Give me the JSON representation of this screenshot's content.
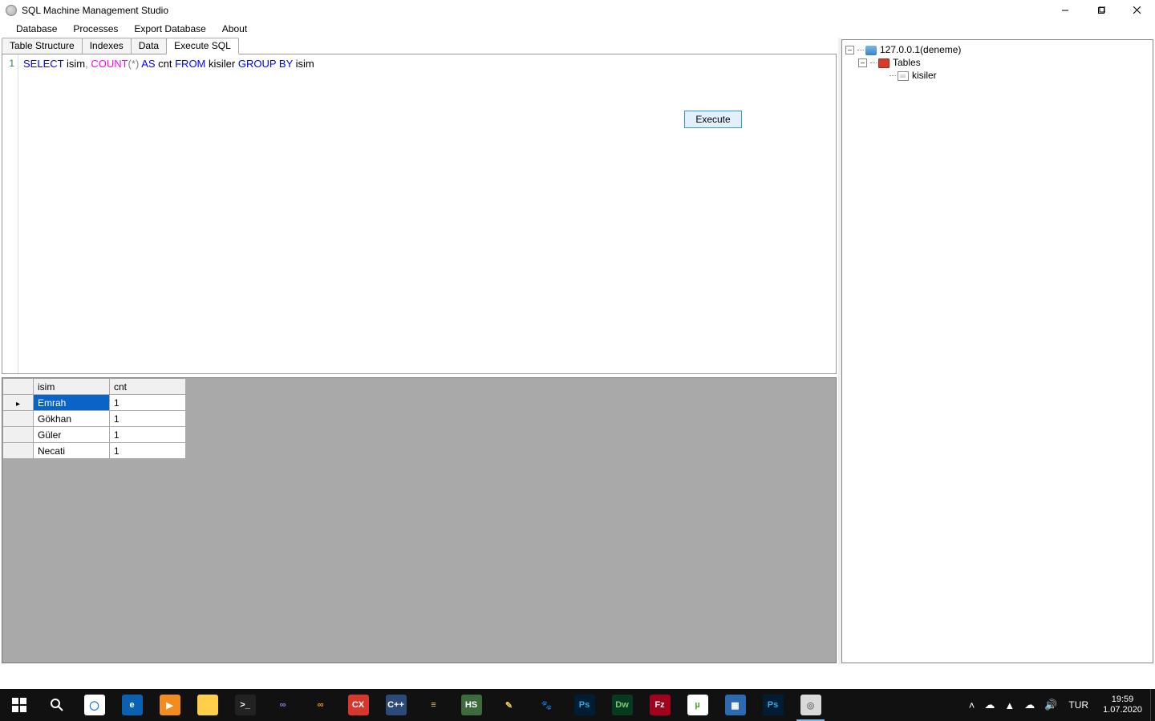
{
  "window": {
    "title": "SQL Machine Management Studio"
  },
  "menu": {
    "items": [
      "Database",
      "Processes",
      "Export Database",
      "About"
    ]
  },
  "tabs": {
    "items": [
      {
        "label": "Table Structure",
        "active": false
      },
      {
        "label": "Indexes",
        "active": false
      },
      {
        "label": "Data",
        "active": false
      },
      {
        "label": "Execute SQL",
        "active": true
      }
    ]
  },
  "editor": {
    "line_numbers": [
      "1"
    ],
    "sql_tokens": [
      {
        "t": "SELECT",
        "c": "kw"
      },
      {
        "t": " isim",
        "c": ""
      },
      {
        "t": ",",
        "c": "op"
      },
      {
        "t": " ",
        "c": ""
      },
      {
        "t": "COUNT",
        "c": "fn"
      },
      {
        "t": "(",
        "c": "op"
      },
      {
        "t": "*",
        "c": "op"
      },
      {
        "t": ")",
        "c": "op"
      },
      {
        "t": " ",
        "c": ""
      },
      {
        "t": "AS",
        "c": "kw"
      },
      {
        "t": " cnt ",
        "c": ""
      },
      {
        "t": "FROM",
        "c": "kw"
      },
      {
        "t": " kisiler ",
        "c": ""
      },
      {
        "t": "GROUP",
        "c": "kw"
      },
      {
        "t": " ",
        "c": ""
      },
      {
        "t": "BY",
        "c": "kw"
      },
      {
        "t": " isim",
        "c": ""
      }
    ],
    "execute_label": "Execute"
  },
  "results": {
    "columns": [
      "isim",
      "cnt"
    ],
    "rows": [
      {
        "isim": "Emrah",
        "cnt": "1",
        "current": true,
        "selected_col": 0
      },
      {
        "isim": "Gökhan",
        "cnt": "1",
        "current": false,
        "selected_col": -1
      },
      {
        "isim": "Güler",
        "cnt": "1",
        "current": false,
        "selected_col": -1
      },
      {
        "isim": "Necati",
        "cnt": "1",
        "current": false,
        "selected_col": -1
      }
    ]
  },
  "tree": {
    "server": {
      "label": "127.0.0.1(deneme)"
    },
    "tables_folder": {
      "label": "Tables"
    },
    "tables": [
      {
        "label": "kisiler"
      }
    ]
  },
  "taskbar": {
    "apps": [
      {
        "name": "start",
        "kind": "start",
        "bg": "",
        "label": ""
      },
      {
        "name": "search",
        "kind": "search",
        "bg": "",
        "label": ""
      },
      {
        "name": "chrome",
        "kind": "color",
        "bg": "#fff",
        "label": "◯",
        "fg": "#1a73e8"
      },
      {
        "name": "edge",
        "kind": "color",
        "bg": "#0b61b1",
        "label": "e"
      },
      {
        "name": "wmplayer",
        "kind": "color",
        "bg": "#f28c1e",
        "label": "▶"
      },
      {
        "name": "explorer",
        "kind": "color",
        "bg": "#ffcf4b",
        "label": ""
      },
      {
        "name": "cmd",
        "kind": "color",
        "bg": "#222",
        "label": ">_"
      },
      {
        "name": "vs",
        "kind": "color",
        "bg": "#111",
        "label": "∞",
        "fg": "#a175d8"
      },
      {
        "name": "vs2",
        "kind": "color",
        "bg": "#111",
        "label": "∞",
        "fg": "#f29b1d"
      },
      {
        "name": "cx",
        "kind": "color",
        "bg": "#d9372c",
        "label": "CX"
      },
      {
        "name": "devcpp",
        "kind": "color",
        "bg": "#2b4a7a",
        "label": "C++"
      },
      {
        "name": "winmerge",
        "kind": "color",
        "bg": "#111",
        "label": "≡",
        "fg": "#f2c94c"
      },
      {
        "name": "hs",
        "kind": "color",
        "bg": "#3d6b3d",
        "label": "HS"
      },
      {
        "name": "np",
        "kind": "color",
        "bg": "#111",
        "label": "✎",
        "fg": "#f2c94c"
      },
      {
        "name": "gimp",
        "kind": "color",
        "bg": "#111",
        "label": "🐾",
        "fg": "#c9a26a"
      },
      {
        "name": "ps",
        "kind": "color",
        "bg": "#001d34",
        "label": "Ps",
        "fg": "#29abe2"
      },
      {
        "name": "dw",
        "kind": "color",
        "bg": "#073b1f",
        "label": "Dw",
        "fg": "#7cc576"
      },
      {
        "name": "filezilla",
        "kind": "color",
        "bg": "#a3001e",
        "label": "Fz"
      },
      {
        "name": "utorrent",
        "kind": "color",
        "bg": "#fff",
        "label": "µ",
        "fg": "#4aa028"
      },
      {
        "name": "taskmgr",
        "kind": "color",
        "bg": "#2d6bb0",
        "label": "▦"
      },
      {
        "name": "ps2",
        "kind": "color",
        "bg": "#001d34",
        "label": "Ps",
        "fg": "#29abe2"
      },
      {
        "name": "thisapp",
        "kind": "color",
        "bg": "#d9d9d9",
        "label": "◎",
        "fg": "#777",
        "active": true
      }
    ],
    "tray_icons": [
      "˄",
      "☁",
      "▲",
      "☁",
      "🔊"
    ],
    "lang": "TUR",
    "time": "19:59",
    "date": "1.07.2020"
  }
}
